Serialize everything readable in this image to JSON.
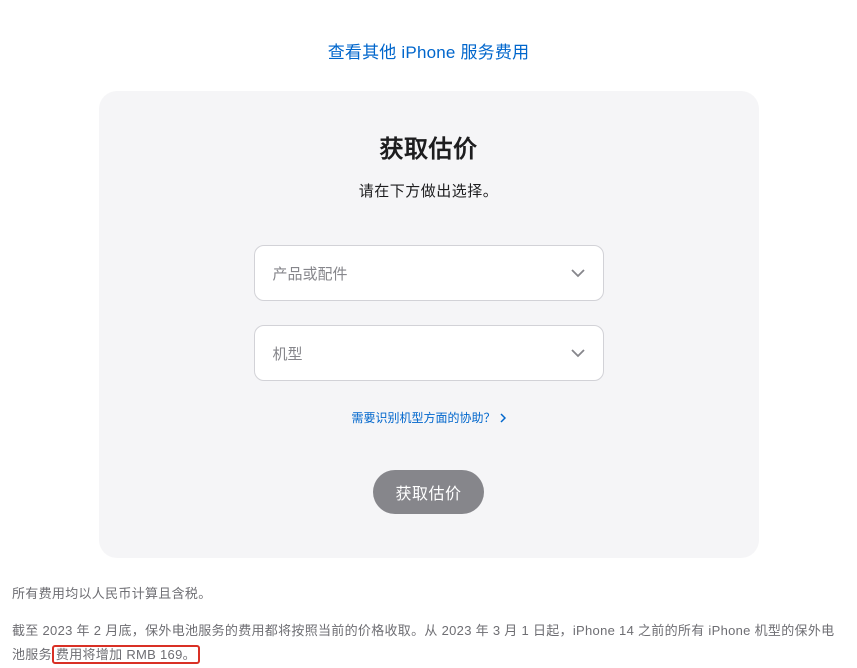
{
  "topLink": {
    "label": "查看其他 iPhone 服务费用"
  },
  "card": {
    "title": "获取估价",
    "subtitle": "请在下方做出选择。",
    "select1": {
      "placeholder": "产品或配件"
    },
    "select2": {
      "placeholder": "机型"
    },
    "helpLink": {
      "label": "需要识别机型方面的协助？"
    },
    "submit": {
      "label": "获取估价"
    }
  },
  "footer": {
    "line1": "所有费用均以人民币计算且含税。",
    "line2_pre": "截至 2023 年 2 月底，保外电池服务的费用都将按照当前的价格收取。从 2023 年 3 月 1 日起，iPhone 14 之前的所有 iPhone 机型的保外电池服务",
    "line2_highlight": "费用将增加 RMB 169。"
  }
}
